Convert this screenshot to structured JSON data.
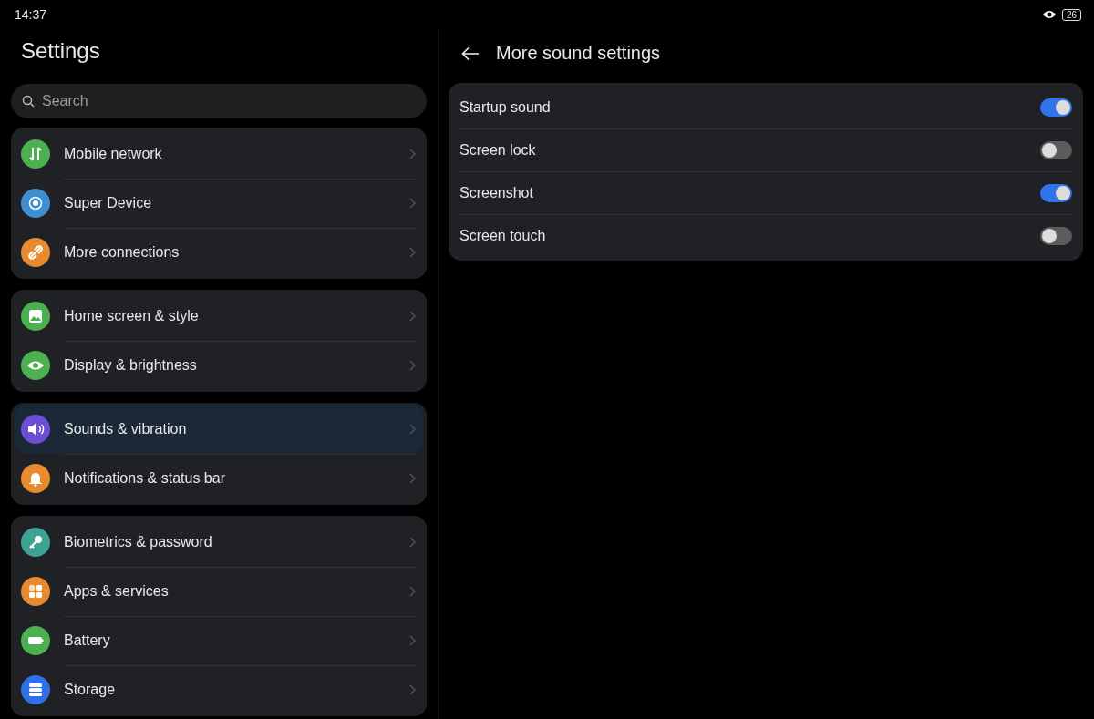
{
  "status_bar": {
    "time": "14:37",
    "battery": "26"
  },
  "sidebar": {
    "title": "Settings",
    "search": {
      "placeholder": "Search"
    },
    "groups": [
      {
        "items": [
          {
            "label": "Mobile network",
            "color": "#4caf50",
            "selected": false
          },
          {
            "label": "Super Device",
            "color": "#3d8fd1",
            "selected": false
          },
          {
            "label": "More connections",
            "color": "#e88a30",
            "selected": false
          }
        ]
      },
      {
        "items": [
          {
            "label": "Home screen & style",
            "color": "#4caf50",
            "selected": false
          },
          {
            "label": "Display & brightness",
            "color": "#4caf50",
            "selected": false
          }
        ]
      },
      {
        "items": [
          {
            "label": "Sounds & vibration",
            "color": "#6b4fd6",
            "selected": true
          },
          {
            "label": "Notifications & status bar",
            "color": "#e88a30",
            "selected": false
          }
        ]
      },
      {
        "items": [
          {
            "label": "Biometrics & password",
            "color": "#3fa394",
            "selected": false
          },
          {
            "label": "Apps & services",
            "color": "#e88a30",
            "selected": false
          },
          {
            "label": "Battery",
            "color": "#4caf50",
            "selected": false
          },
          {
            "label": "Storage",
            "color": "#2f6fe8",
            "selected": false
          }
        ]
      }
    ]
  },
  "detail": {
    "title": "More sound settings",
    "settings": [
      {
        "label": "Startup sound",
        "on": true
      },
      {
        "label": "Screen lock",
        "on": false
      },
      {
        "label": "Screenshot",
        "on": true
      },
      {
        "label": "Screen touch",
        "on": false
      }
    ]
  }
}
